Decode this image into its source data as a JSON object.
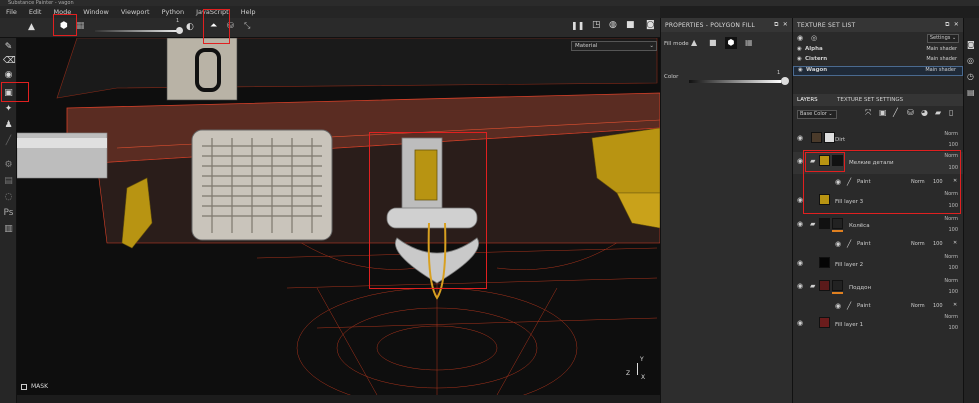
{
  "window": {
    "title": "Substance Painter - vagon"
  },
  "menu": [
    "File",
    "Edit",
    "Mode",
    "Window",
    "Viewport",
    "Python",
    "JavaScript",
    "Help"
  ],
  "toolbar": {
    "slider_value": "1"
  },
  "viewport": {
    "material_select": "Material",
    "mask_label": "MASK",
    "axes": {
      "y": "Y",
      "z": "Z",
      "x": "X"
    }
  },
  "properties": {
    "title": "PROPERTIES - POLYGON FILL",
    "fill_mode_label": "Fill mode",
    "color_label": "Color",
    "color_value": "1"
  },
  "texture_sets": {
    "title": "TEXTURE SET LIST",
    "settings_button": "Settings",
    "items": [
      {
        "name": "Alpha",
        "shader": "Main shader"
      },
      {
        "name": "Cistern",
        "shader": "Main shader"
      },
      {
        "name": "Wagon",
        "shader": "Main shader"
      }
    ]
  },
  "layers": {
    "tab_layers": "LAYERS",
    "tab_settings": "TEXTURE SET SETTINGS",
    "channel_select": "Base Color",
    "items": [
      {
        "name": "Dirt",
        "blend": "Norm",
        "opacity": "100"
      },
      {
        "name": "Мелкие детали",
        "blend": "Norm",
        "opacity": "100"
      },
      {
        "name": "Paint",
        "blend": "Norm",
        "opacity": "100"
      },
      {
        "name": "Fill layer 3",
        "blend": "Norm",
        "opacity": "100"
      },
      {
        "name": "Колёса",
        "blend": "Norm",
        "opacity": "100"
      },
      {
        "name": "Paint",
        "blend": "Norm",
        "opacity": "100"
      },
      {
        "name": "Fill layer 2",
        "blend": "Norm",
        "opacity": "100"
      },
      {
        "name": "Поддон",
        "blend": "Norm",
        "opacity": "100"
      },
      {
        "name": "Paint",
        "blend": "Norm",
        "opacity": "100"
      },
      {
        "name": "Fill layer 1",
        "blend": "Norm",
        "opacity": "100"
      }
    ]
  },
  "colors": {
    "accent": "#e02020",
    "yellow": "#b89412",
    "wireframe": "#c83a1e"
  }
}
